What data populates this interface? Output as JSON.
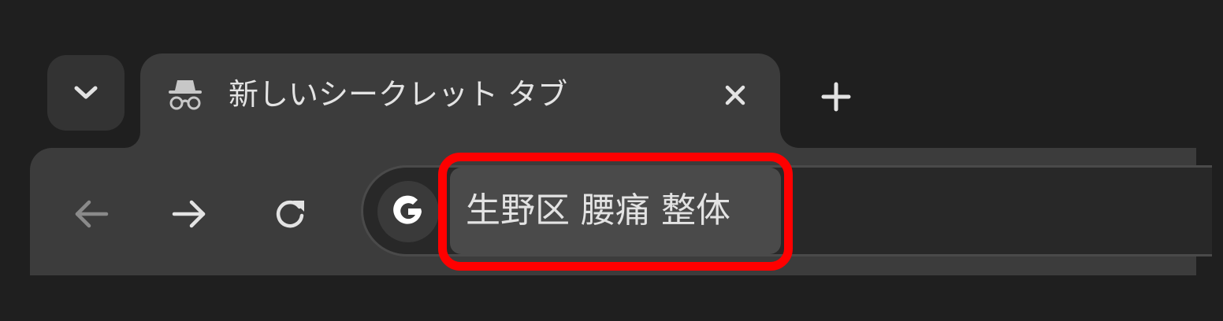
{
  "tab_strip": {
    "active_tab": {
      "title": "新しいシークレット タブ",
      "icon": "incognito-icon",
      "close_icon": "close-icon"
    },
    "tab_search_icon": "chevron-down-icon",
    "new_tab_icon": "plus-icon"
  },
  "toolbar": {
    "back_icon": "arrow-left-icon",
    "forward_icon": "arrow-right-icon",
    "reload_icon": "reload-icon"
  },
  "omnibox": {
    "engine_icon": "google-g-icon",
    "query": "生野区 腰痛 整体"
  },
  "colors": {
    "background": "#1f1f1f",
    "tab_bg": "#3c3c3c",
    "text": "#e3e3e3",
    "highlight": "#ff0000"
  }
}
